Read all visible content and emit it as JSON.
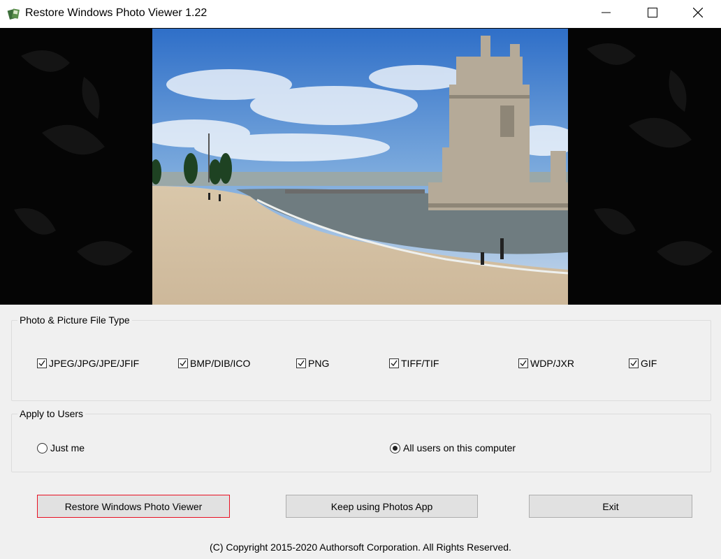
{
  "window": {
    "title": "Restore Windows Photo Viewer 1.22",
    "controls": [
      "minimize-icon",
      "maximize-icon",
      "close-icon"
    ]
  },
  "preview": {
    "description_icon": "photo-preview"
  },
  "file_types": {
    "legend": "Photo & Picture File Type",
    "items": [
      {
        "label": "JPEG/JPG/JPE/JFIF",
        "checked": true
      },
      {
        "label": "BMP/DIB/ICO",
        "checked": true
      },
      {
        "label": "PNG",
        "checked": true
      },
      {
        "label": "TIFF/TIF",
        "checked": true
      },
      {
        "label": "WDP/JXR",
        "checked": true
      },
      {
        "label": "GIF",
        "checked": true
      }
    ]
  },
  "users": {
    "legend": "Apply to Users",
    "options": [
      {
        "label": "Just me",
        "selected": false
      },
      {
        "label": "All users on this computer",
        "selected": true
      }
    ]
  },
  "buttons": {
    "restore": "Restore Windows Photo Viewer",
    "keep": "Keep using Photos App",
    "exit": "Exit"
  },
  "footer": {
    "copyright": "(C) Copyright 2015-2020 Authorsoft Corporation. All Rights Reserved."
  },
  "colors": {
    "focus_border": "#e81123",
    "window_bg": "#f0f0f0"
  }
}
